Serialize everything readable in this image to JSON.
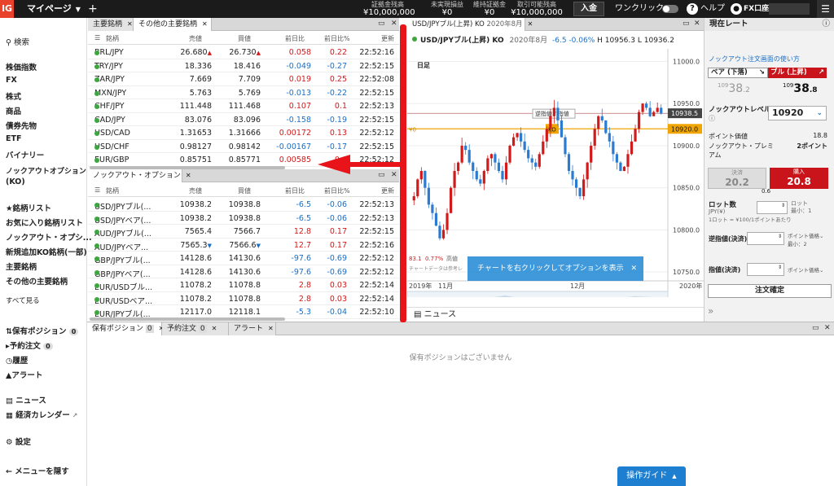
{
  "topbar": {
    "logo": "IG",
    "mypage": "マイページ",
    "stats": [
      {
        "label": "証拠金残高",
        "value": "¥10,000,000"
      },
      {
        "label": "未実現損益",
        "value": "¥0"
      },
      {
        "label": "維持証拠金",
        "value": "¥0"
      },
      {
        "label": "取引可能残高",
        "value": "¥10,000,000"
      }
    ],
    "deposit": "入金",
    "oneclick": "ワンクリック",
    "help": "ヘルプ",
    "user": "FX口座"
  },
  "sidebar": {
    "search": "検索",
    "markets": [
      "株価指数",
      "FX",
      "株式",
      "商品",
      "債券先物",
      "ETF",
      "バイナリー",
      "ノックアウトオプション",
      "(KO)"
    ],
    "watchlist_header": "銘柄リスト",
    "watchlists": [
      "お気に入り銘柄リスト",
      "ノックアウト・オプシ...",
      "新規追加KO銘柄(一部)",
      "主要銘柄",
      "その他の主要銘柄"
    ],
    "see_all": "すべて見る",
    "positions": "保有ポジション",
    "positions_count": "0",
    "orders": "予約注文",
    "orders_count": "0",
    "history": "履歴",
    "alerts": "アラート",
    "news": "ニュース",
    "calendar": "経済カレンダー",
    "settings": "設定",
    "hide_menu": "メニューを隠す"
  },
  "top_grid": {
    "tabs": [
      "主要銘柄",
      "その他の主要銘柄"
    ],
    "columns": [
      "銘柄",
      "売値",
      "買値",
      "前日比",
      "前日比%",
      "更新"
    ],
    "rows": [
      {
        "name": "BRL/JPY",
        "sell": "26.680",
        "sell_arrow": "▲",
        "buy": "26.730",
        "buy_arrow": "▲",
        "chg": "0.058",
        "chgp": "0.22",
        "time": "22:52:16",
        "dir": "pos"
      },
      {
        "name": "TRY/JPY",
        "sell": "18.336",
        "sell_arrow": "",
        "buy": "18.416",
        "buy_arrow": "",
        "chg": "-0.049",
        "chgp": "-0.27",
        "time": "22:52:15",
        "dir": "neg"
      },
      {
        "name": "ZAR/JPY",
        "sell": "7.669",
        "sell_arrow": "",
        "buy": "7.709",
        "buy_arrow": "",
        "chg": "0.019",
        "chgp": "0.25",
        "time": "22:52:08",
        "dir": "pos"
      },
      {
        "name": "MXN/JPY",
        "sell": "5.763",
        "sell_arrow": "",
        "buy": "5.769",
        "buy_arrow": "",
        "chg": "-0.013",
        "chgp": "-0.22",
        "time": "22:52:15",
        "dir": "neg"
      },
      {
        "name": "CHF/JPY",
        "sell": "111.448",
        "sell_arrow": "",
        "buy": "111.468",
        "buy_arrow": "",
        "chg": "0.107",
        "chgp": "0.1",
        "time": "22:52:13",
        "dir": "pos"
      },
      {
        "name": "CAD/JPY",
        "sell": "83.076",
        "sell_arrow": "",
        "buy": "83.096",
        "buy_arrow": "",
        "chg": "-0.158",
        "chgp": "-0.19",
        "time": "22:52:15",
        "dir": "neg"
      },
      {
        "name": "USD/CAD",
        "sell": "1.31653",
        "sell_arrow": "",
        "buy": "1.31666",
        "buy_arrow": "",
        "chg": "0.00172",
        "chgp": "0.13",
        "time": "22:52:12",
        "dir": "pos"
      },
      {
        "name": "USD/CHF",
        "sell": "0.98127",
        "sell_arrow": "",
        "buy": "0.98142",
        "buy_arrow": "",
        "chg": "-0.00167",
        "chgp": "-0.17",
        "time": "22:52:15",
        "dir": "neg"
      },
      {
        "name": "EUR/GBP",
        "sell": "0.85751",
        "sell_arrow": "",
        "buy": "0.85771",
        "buy_arrow": "",
        "chg": "0.00585",
        "chgp": "0.6",
        "time": "22:52:12",
        "dir": "pos"
      }
    ]
  },
  "ko_grid": {
    "tab": "ノックアウト・オプション",
    "columns": [
      "銘柄",
      "売値",
      "買値",
      "前日比",
      "前日比%",
      "更新"
    ],
    "rows": [
      {
        "name": "USD/JPYブル(...",
        "sell": "10938.2",
        "sell_arrow": "",
        "buy": "10938.8",
        "buy_arrow": "",
        "chg": "-6.5",
        "chgp": "-0.06",
        "time": "22:52:13",
        "dir": "neg"
      },
      {
        "name": "USD/JPYベア(...",
        "sell": "10938.2",
        "sell_arrow": "",
        "buy": "10938.8",
        "buy_arrow": "",
        "chg": "-6.5",
        "chgp": "-0.06",
        "time": "22:52:13",
        "dir": "neg"
      },
      {
        "name": "AUD/JPYブル(...",
        "sell": "7565.4",
        "sell_arrow": "",
        "buy": "7566.7",
        "buy_arrow": "",
        "chg": "12.8",
        "chgp": "0.17",
        "time": "22:52:15",
        "dir": "pos"
      },
      {
        "name": "AUD/JPYベア...",
        "sell": "7565.3",
        "sell_arrow": "▼",
        "buy": "7566.6",
        "buy_arrow": "▼",
        "chg": "12.7",
        "chgp": "0.17",
        "time": "22:52:16",
        "dir": "pos"
      },
      {
        "name": "GBP/JPYブル(...",
        "sell": "14128.6",
        "sell_arrow": "",
        "buy": "14130.6",
        "buy_arrow": "",
        "chg": "-97.6",
        "chgp": "-0.69",
        "time": "22:52:12",
        "dir": "neg"
      },
      {
        "name": "GBP/JPYベア(...",
        "sell": "14128.6",
        "sell_arrow": "",
        "buy": "14130.6",
        "buy_arrow": "",
        "chg": "-97.6",
        "chgp": "-0.69",
        "time": "22:52:12",
        "dir": "neg"
      },
      {
        "name": "EUR/USDブル...",
        "sell": "11078.2",
        "sell_arrow": "",
        "buy": "11078.8",
        "buy_arrow": "",
        "chg": "2.8",
        "chgp": "0.03",
        "time": "22:52:14",
        "dir": "pos"
      },
      {
        "name": "EUR/USDベア...",
        "sell": "11078.2",
        "sell_arrow": "",
        "buy": "11078.8",
        "buy_arrow": "",
        "chg": "2.8",
        "chgp": "0.03",
        "time": "22:52:14",
        "dir": "pos"
      },
      {
        "name": "EUR/JPYブル(...",
        "sell": "12117.0",
        "sell_arrow": "",
        "buy": "12118.1",
        "buy_arrow": "",
        "chg": "-5.3",
        "chgp": "-0.04",
        "time": "22:52:10",
        "dir": "neg"
      }
    ]
  },
  "chart": {
    "tab": "USD/JPYブル(上昇) KO",
    "tab_date": "2020年8月",
    "title": "USD/JPYブル(上昇) KO",
    "period": "2020年8月",
    "change": "-6.5",
    "change_pct": "-0.06%",
    "high": "H 10956.3",
    "low": "L 10936.2",
    "timeframe": "日足",
    "y_labels": [
      "11000.0",
      "10950.0",
      "10900.0",
      "10850.0",
      "10800.0",
      "10750.0"
    ],
    "price_tag": "10938.5",
    "ko_tag": "10920.0",
    "ko_label": "KO",
    "stop_label": "逆指値 / 指値",
    "left_marker": "¥0",
    "overlay_text": "チャートを右クリックしてオプションを表示",
    "x_labels": [
      "2019年",
      "11月",
      "12月",
      "2020年"
    ],
    "footer_left": "83.1",
    "footer_pct": "0.77%",
    "footer_high": "高値",
    "footer_note": "チャートデータは参考レ",
    "nav_years": [
      "1996年",
      "2002年",
      "2008年",
      "2012年",
      "2016年"
    ],
    "news": "ニュース"
  },
  "rate_panel": {
    "title": "現在レート",
    "link": "ノックアウト注文画面の使い方",
    "bear": "ベア (下落)",
    "bull": "ブル (上昇)",
    "bear_small": "109",
    "bear_big": "38",
    "bear_dec": ".2",
    "bull_small": "109",
    "bull_big": "38",
    "bull_dec": ".8",
    "ko_level_label": "ノックアウトレベル",
    "ko_level": "10920",
    "point_value_label": "ポイント価値",
    "point_value": "18.8",
    "premium_label": "ノックアウト・プレミアム",
    "premium_value": "2ポイント",
    "settle_label": "決済",
    "settle_price": "20.2",
    "buy_label": "購入",
    "buy_price": "20.8",
    "spread": "0.6",
    "lot_label": "ロット数",
    "lot_unit": "JPY(¥)",
    "lot_hint": "ロット",
    "lot_min": "最小：1",
    "lot_note": "1ロット = ¥100/1ポイントあたり",
    "stop_label": "逆指値(決済)",
    "stop_pts": "ポイント価格",
    "stop_min": "最小：2",
    "limit_label": "指値(決済)",
    "limit_pts": "ポイント価格",
    "confirm": "注文確定"
  },
  "bottom": {
    "tabs": [
      {
        "label": "保有ポジション",
        "count": "0"
      },
      {
        "label": "予約注文",
        "count": "0"
      },
      {
        "label": "アラート",
        "count": ""
      }
    ],
    "empty": "保有ポジションはございません"
  },
  "guide": "操作ガイド"
}
